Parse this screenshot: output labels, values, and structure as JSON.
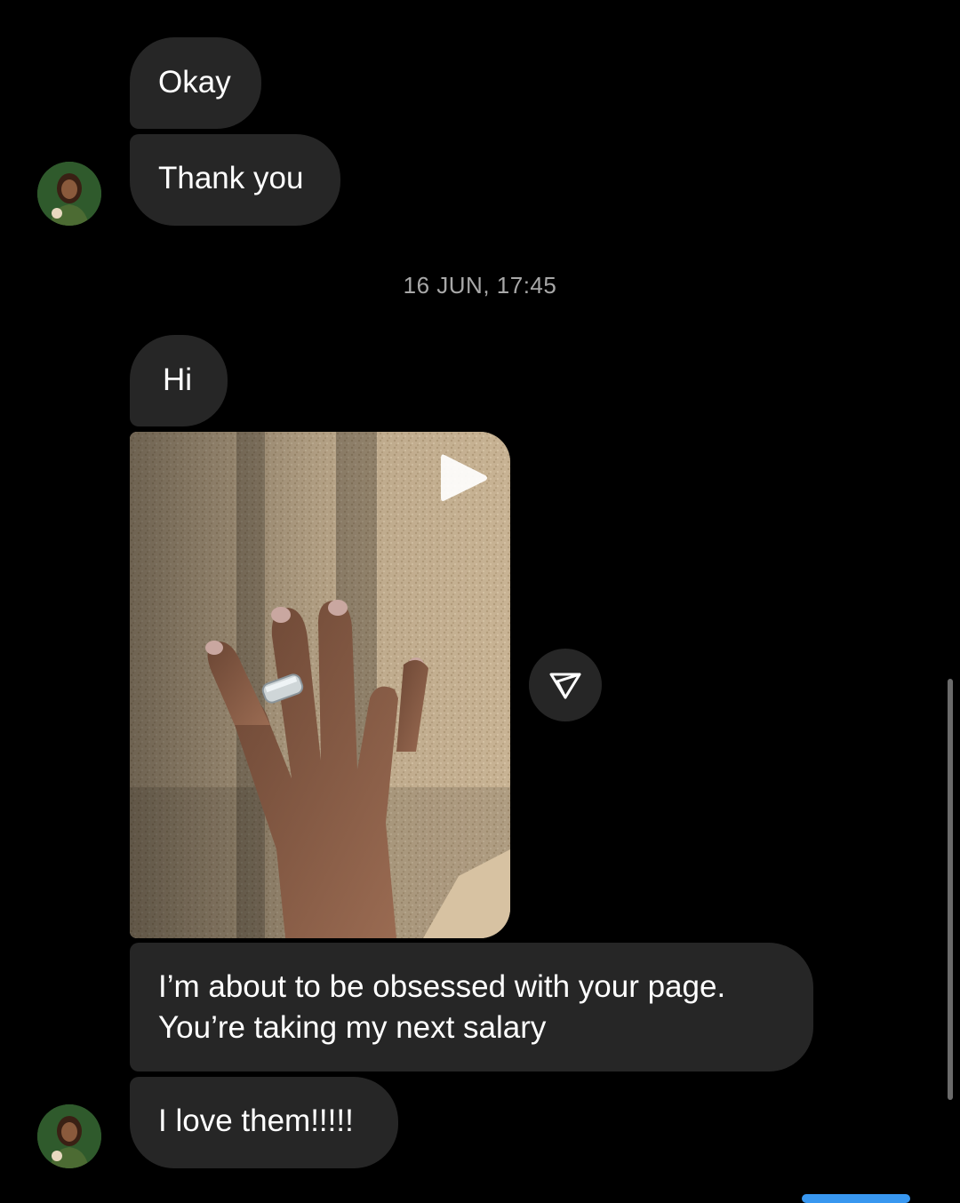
{
  "conversation": {
    "messages_before": [
      {
        "text": "Okay"
      },
      {
        "text": "Thank you"
      }
    ],
    "timestamp": "16 JUN, 17:45",
    "messages_after": [
      {
        "text": "Hi"
      },
      {
        "lines": [
          "I’m about to be obsessed with your page.",
          "You’re taking my next salary"
        ]
      },
      {
        "text": "I love them!!!!!"
      }
    ]
  },
  "media": {
    "type": "video",
    "icons": {
      "play": "play-icon",
      "share": "paper-plane-icon"
    }
  },
  "avatar": {
    "icon": "avatar-image"
  },
  "colors": {
    "background": "#000000",
    "bubble": "#262626",
    "timestamp": "#a8a8a8",
    "accent": "#3897f0"
  }
}
